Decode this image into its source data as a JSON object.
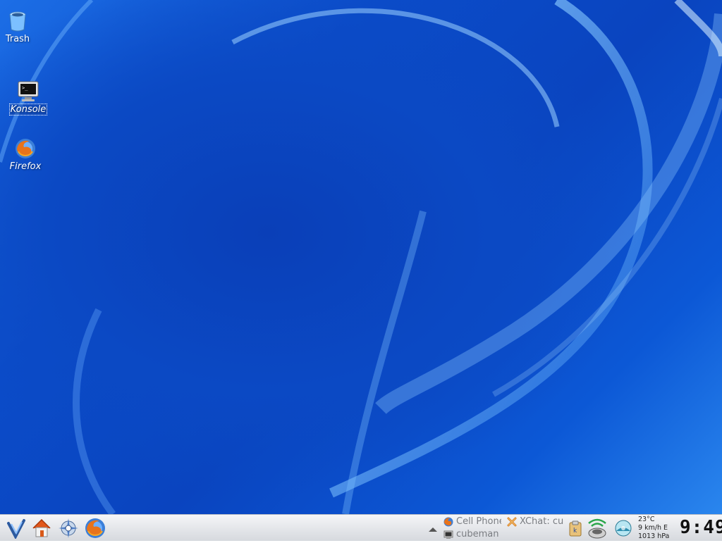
{
  "desktop": {
    "wallpaper_colors": [
      "#0a44bf",
      "#1c6ee6",
      "#2a86ee"
    ],
    "icons": [
      {
        "label": "Trash",
        "icon": "trash-icon"
      },
      {
        "label": "Konsole",
        "icon": "terminal-icon",
        "selected": true
      },
      {
        "label": "Firefox",
        "icon": "firefox-icon"
      }
    ]
  },
  "taskbar": {
    "launchers": [
      {
        "icon": "kde-menu-icon"
      },
      {
        "icon": "home-icon"
      },
      {
        "icon": "konqueror-icon"
      },
      {
        "icon": "firefox-icon"
      }
    ],
    "tasks": [
      {
        "label": "Cell Phone",
        "icon": "firefox-icon"
      },
      {
        "label": "XChat: cu",
        "icon": "xchat-icon"
      },
      {
        "label": "cubeman",
        "icon": "terminal-icon"
      }
    ],
    "tray": [
      {
        "icon": "show-more-arrow-icon"
      },
      {
        "icon": "klipper-icon"
      },
      {
        "icon": "wireless-icon"
      },
      {
        "icon": "weather-icon"
      }
    ],
    "weather": {
      "temperature": "23°C",
      "wind": "9 km/h E",
      "pressure": "1013 hPa"
    },
    "clock": "9:49"
  }
}
